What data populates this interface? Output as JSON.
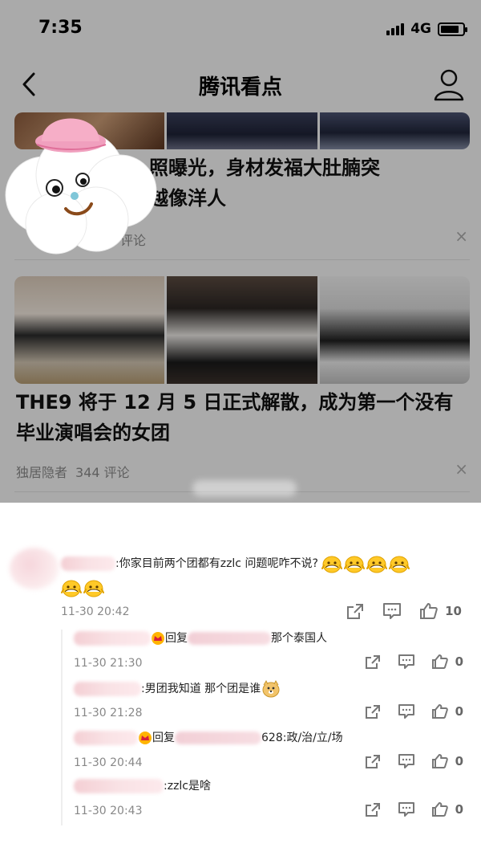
{
  "status_bar": {
    "time": "7:35",
    "network": "4G"
  },
  "navbar": {
    "title": "腾讯看点"
  },
  "feed": {
    "article1": {
      "headline_line1": "照曝光，身材发福大肚腩突",
      "headline_line2": "越像洋人",
      "meta_comments": "评论"
    },
    "article2": {
      "headline": "THE9 将于 12 月 5 日正式解散，成为第一个没有毕业演唱会的女团",
      "source": "独居隐者",
      "comments": "344 评论"
    },
    "close_symbol": "×"
  },
  "comment": {
    "text": ":你家目前两个团都有zzlc 问题呢咋不说?",
    "time": "11-30 20:42",
    "likes": "10",
    "replies": [
      {
        "prefix": "回复",
        "text": "那个泰国人",
        "time": "11-30 21:30",
        "likes": "0"
      },
      {
        "prefix": "",
        "text": ":男团我知道 那个团是谁",
        "time": "11-30 21:28",
        "likes": "0"
      },
      {
        "prefix": "回复",
        "text": "628:政/治/立/场",
        "time": "11-30 20:44",
        "likes": "0"
      },
      {
        "prefix": "",
        "text": ":zzlc是啥",
        "time": "11-30 20:43",
        "likes": "0"
      }
    ]
  },
  "colors": {
    "accent": "#ff8a00",
    "dim_overlay": "rgba(0,0,0,0.30)",
    "sticker_hat": "#f3a2bd"
  }
}
